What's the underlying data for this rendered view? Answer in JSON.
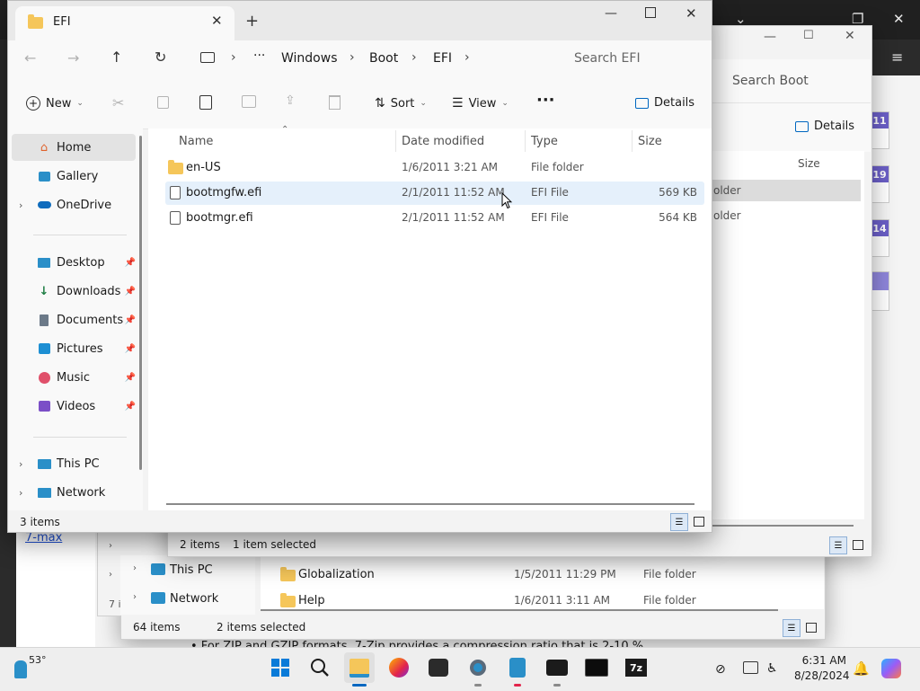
{
  "bg_browser": {
    "link_text": "7-max",
    "page_text": "• For ZIP and GZIP formats, 7-Zip provides a compression ratio that is 2-10 %",
    "side_badges": [
      "11",
      "19",
      "14"
    ]
  },
  "window_boot": {
    "search_placeholder": "Search Boot",
    "details_label": "Details",
    "size_header": "Size",
    "rows_partial": [
      "older",
      "older"
    ],
    "status_items": "2 items",
    "status_selected": "1 item selected"
  },
  "window_root": {
    "nav": [
      "This PC",
      "Network"
    ],
    "rows": [
      {
        "name": "Globalization",
        "date": "1/5/2011 11:29 PM",
        "type": "File folder"
      },
      {
        "name": "Help",
        "date": "1/6/2011 3:11 AM",
        "type": "File folder"
      }
    ],
    "status_items": "64 items",
    "status_selected": "2 items selected",
    "left_partial": "7 i"
  },
  "front": {
    "tab_title": "EFI",
    "breadcrumb": [
      "Windows",
      "Boot",
      "EFI"
    ],
    "search_placeholder": "Search EFI",
    "toolbar": {
      "new": "New",
      "sort": "Sort",
      "view": "View",
      "details": "Details"
    },
    "nav": {
      "home": "Home",
      "gallery": "Gallery",
      "onedrive": "OneDrive",
      "desktop": "Desktop",
      "downloads": "Downloads",
      "documents": "Documents",
      "pictures": "Pictures",
      "music": "Music",
      "videos": "Videos",
      "thispc": "This PC",
      "network": "Network"
    },
    "columns": {
      "name": "Name",
      "date": "Date modified",
      "type": "Type",
      "size": "Size"
    },
    "files": [
      {
        "name": "en-US",
        "date": "1/6/2011 3:21 AM",
        "type": "File folder",
        "size": ""
      },
      {
        "name": "bootmgfw.efi",
        "date": "2/1/2011 11:52 AM",
        "type": "EFI File",
        "size": "569 KB"
      },
      {
        "name": "bootmgr.efi",
        "date": "2/1/2011 11:52 AM",
        "type": "EFI File",
        "size": "564 KB"
      }
    ],
    "status": "3 items"
  },
  "taskbar": {
    "weather_temp": "53°",
    "time": "6:31 AM",
    "date": "8/28/2024"
  },
  "colors": {
    "accent": "#0067c0",
    "selected_row": "#e5f0fb",
    "folder": "#f5c65a"
  }
}
